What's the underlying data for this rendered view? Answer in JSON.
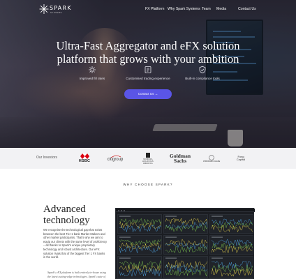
{
  "brand": {
    "name": "SPARK",
    "tagline": "SYSTEMS"
  },
  "nav": {
    "items": [
      {
        "label": "FX Platform"
      },
      {
        "label": "Why Spark Systems"
      },
      {
        "label": "Team"
      },
      {
        "label": "Media"
      },
      {
        "label": "Contact Us"
      }
    ]
  },
  "hero": {
    "headline_line1": "Ultra-Fast Aggregator and eFX solution",
    "headline_line2": "platform that grows with your ambition",
    "features": [
      {
        "icon": "fill-rate-icon",
        "label": "Improved fill rates"
      },
      {
        "icon": "trading-experience-icon",
        "label": "Customised trading experience"
      },
      {
        "icon": "compliance-icon",
        "label": "Built-in compliance tools"
      }
    ],
    "cta_label": "Contact Us  →"
  },
  "investors": {
    "label": "Our Investors",
    "logos": [
      {
        "name": "HSBC",
        "text": "HSBC"
      },
      {
        "name": "citigroup",
        "text": "citigroup"
      },
      {
        "name": "Nomura",
        "text": "NOMURA HOLDINGS AMERICA"
      },
      {
        "name": "Goldman Sachs",
        "line1": "Goldman",
        "line2": "Sachs"
      },
      {
        "name": "J.P. Morgan",
        "text": "JPMORGAN CHASE"
      },
      {
        "name": "Fongcha",
        "line1": "Fong",
        "line2": "Capital"
      }
    ]
  },
  "why": {
    "kicker": "WHY CHOOSE SPARK?",
    "title_line1": "Advanced",
    "title_line2": "technology",
    "body": "We recognise the technological gap that exists between the best Tier 1 bank Market Makers and other market participants. That's why we aim to equip our clients with the same level of proficiency – all thanks to Spark's unique proprietary technology and robust architecture. Our eFX solution rivals that of the biggest Tier 1 FX banks in the world.",
    "quote": "Spark's eFX platform is built entirely in-house using the latest cutting-edge technologies. Spark's suite of"
  },
  "colors": {
    "accent": "#5a55e6",
    "dash_bg": "#1b1d22",
    "line_green": "#7ec850",
    "line_yellow": "#e8d44d",
    "line_blue": "#4fa3e0"
  }
}
